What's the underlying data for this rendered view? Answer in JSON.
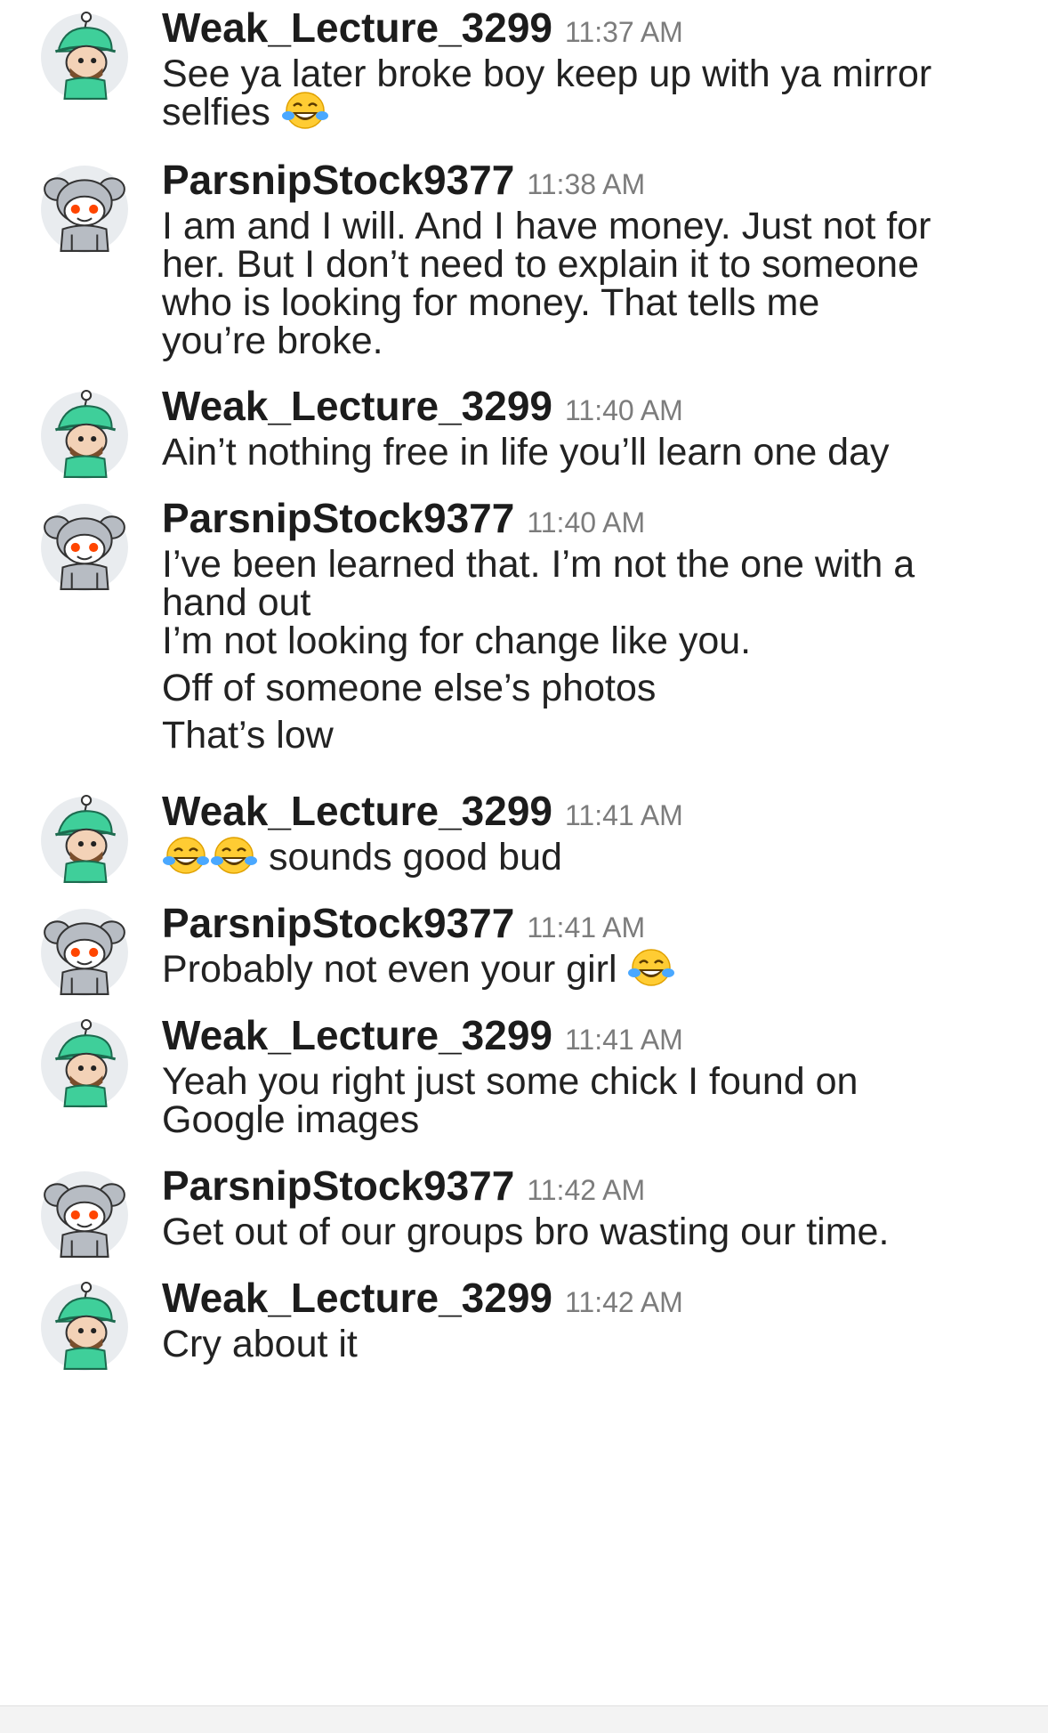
{
  "messages": [
    {
      "user": "Weak_Lecture_3299",
      "time": "11:37 AM",
      "avatar": "green-snoo-avatar",
      "lines": [
        [
          "See ya later broke boy keep up with ya mirror"
        ],
        [
          "selfies ",
          "[joy-emoji]"
        ]
      ]
    },
    {
      "user": "ParsnipStock9377",
      "time": "11:38 AM",
      "avatar": "koala-snoo-avatar",
      "lines": [
        [
          "I am and I will. And I have money. Just not for"
        ],
        [
          "her. But I don’t need to explain it to someone"
        ],
        [
          "who is looking for money.  That tells me"
        ],
        [
          "you’re broke."
        ]
      ]
    },
    {
      "user": "Weak_Lecture_3299",
      "time": "11:40 AM",
      "avatar": "green-snoo-avatar",
      "lines": [
        [
          "Ain’t nothing free in life you’ll learn one day"
        ]
      ]
    },
    {
      "user": "ParsnipStock9377",
      "time": "11:40 AM",
      "avatar": "koala-snoo-avatar",
      "lines": [
        [
          "I’ve been learned that. I’m not the one with a"
        ],
        [
          "hand out"
        ]
      ],
      "extra_lines": [
        "I’m not looking for change like you.",
        "Off of someone else’s photos",
        "That’s low"
      ]
    },
    {
      "user": "Weak_Lecture_3299",
      "time": "11:41 AM",
      "avatar": "green-snoo-avatar",
      "lines": [
        [
          "[joy-emoji]",
          "[joy-emoji]",
          " sounds good bud"
        ]
      ]
    },
    {
      "user": "ParsnipStock9377",
      "time": "11:41 AM",
      "avatar": "koala-snoo-avatar",
      "lines": [
        [
          "Probably not even your girl ",
          "[joy-emoji]"
        ]
      ]
    },
    {
      "user": "Weak_Lecture_3299",
      "time": "11:41 AM",
      "avatar": "green-snoo-avatar",
      "lines": [
        [
          "Yeah you right just some chick I found on"
        ],
        [
          "Google images"
        ]
      ]
    },
    {
      "user": "ParsnipStock9377",
      "time": "11:42 AM",
      "avatar": "koala-snoo-avatar",
      "lines": [
        [
          "Get out of our groups bro wasting our time."
        ]
      ]
    },
    {
      "user": "Weak_Lecture_3299",
      "time": "11:42 AM",
      "avatar": "green-snoo-avatar",
      "lines": [
        [
          "Cry about it"
        ]
      ]
    }
  ],
  "icons": {
    "emoji": "face-with-tears-of-joy-icon"
  },
  "colors": {
    "username": "#1c1c1c",
    "timestamp": "#7c7c7c",
    "avatar_bg": "#e9ecef",
    "green": "#3fcf9a",
    "snoo_red": "#ff4500"
  }
}
